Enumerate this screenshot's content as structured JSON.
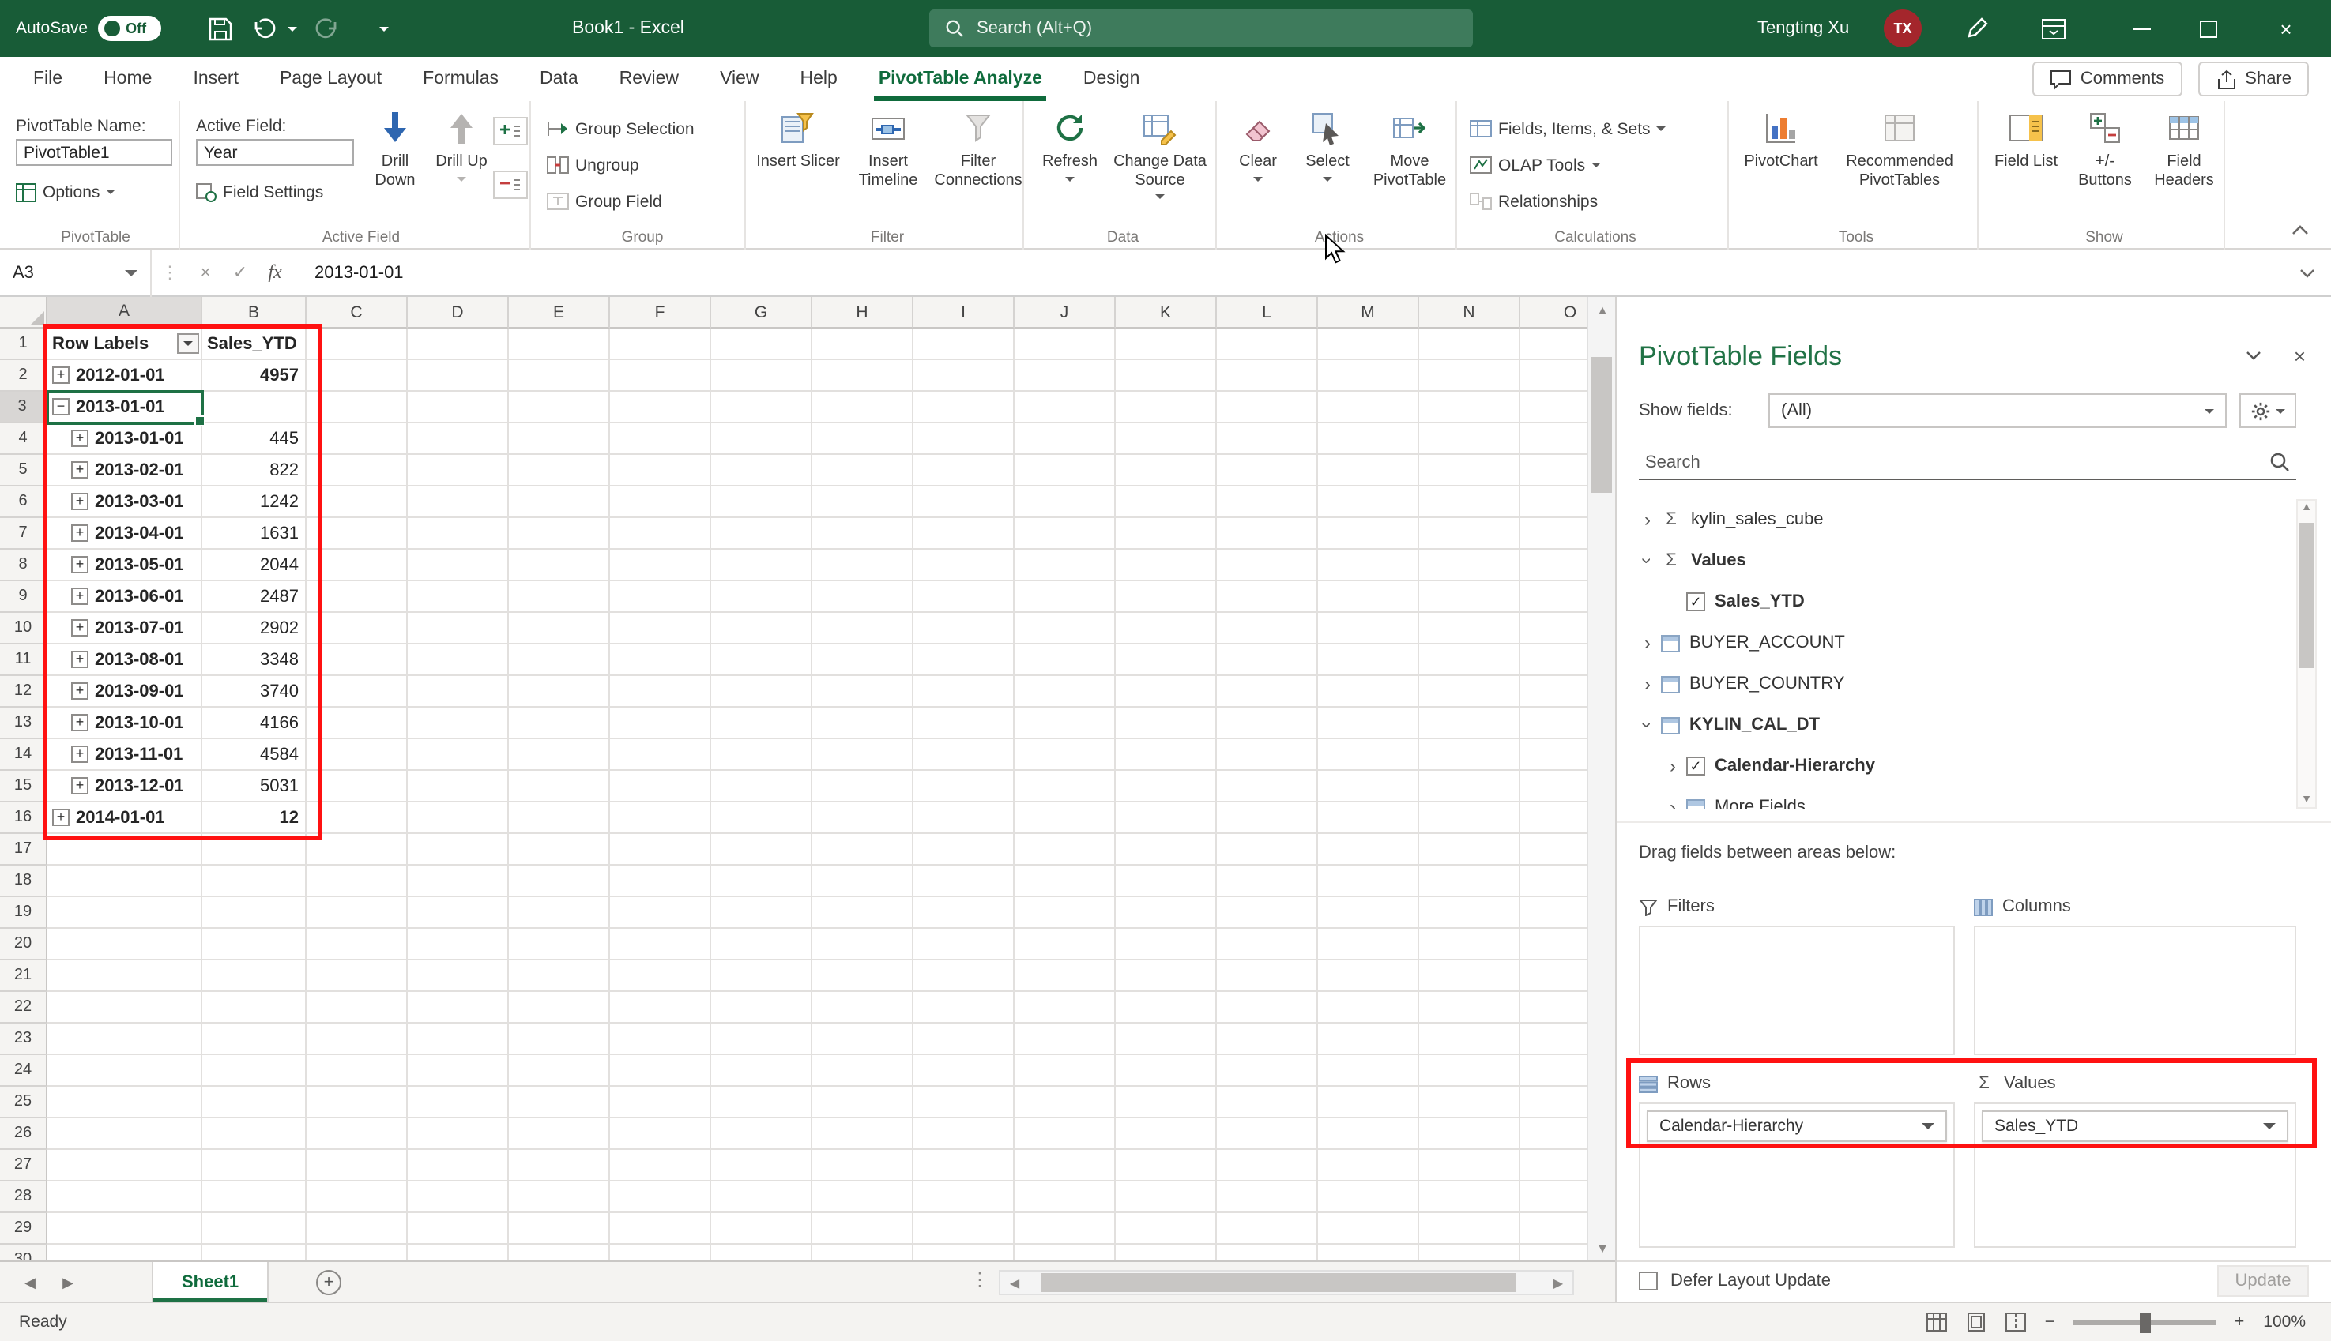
{
  "colors": {
    "titlebar_green": "#185C37",
    "accent_green": "#217346",
    "annotation_red": "#FF0000",
    "avatar_red": "#A4262C"
  },
  "titlebar": {
    "autosave_label": "AutoSave",
    "autosave_state": "Off",
    "document_title": "Book1 - Excel",
    "search_placeholder": "Search (Alt+Q)",
    "user_name": "Tengting Xu",
    "user_initials": "TX"
  },
  "menu": {
    "tabs": [
      "File",
      "Home",
      "Insert",
      "Page Layout",
      "Formulas",
      "Data",
      "Review",
      "View",
      "Help",
      "PivotTable Analyze",
      "Design"
    ],
    "active_tab": "PivotTable Analyze",
    "comments_label": "Comments",
    "share_label": "Share"
  },
  "ribbon": {
    "pivottable": {
      "group_label": "PivotTable",
      "name_label": "PivotTable Name:",
      "name_value": "PivotTable1",
      "options_label": "Options"
    },
    "active_field": {
      "group_label": "Active Field",
      "field_label": "Active Field:",
      "field_value": "Year",
      "settings_label": "Field Settings",
      "drill_down": "Drill Down",
      "drill_up": "Drill Up"
    },
    "group": {
      "group_label": "Group",
      "selection": "Group Selection",
      "ungroup": "Ungroup",
      "field": "Group Field"
    },
    "filter": {
      "group_label": "Filter",
      "slicer": "Insert Slicer",
      "timeline": "Insert Timeline",
      "connections": "Filter Connections"
    },
    "data": {
      "group_label": "Data",
      "refresh": "Refresh",
      "change_source": "Change Data Source"
    },
    "actions": {
      "group_label": "Actions",
      "clear": "Clear",
      "select": "Select",
      "move": "Move PivotTable"
    },
    "calculations": {
      "group_label": "Calculations",
      "fields_items": "Fields, Items, & Sets",
      "olap": "OLAP Tools",
      "relationships": "Relationships"
    },
    "tools": {
      "group_label": "Tools",
      "pivotchart": "PivotChart",
      "recommended": "Recommended PivotTables"
    },
    "show": {
      "group_label": "Show",
      "field_list": "Field List",
      "buttons": "+/- Buttons",
      "headers": "Field Headers"
    }
  },
  "formula_bar": {
    "name_box": "A3",
    "content": "2013-01-01"
  },
  "grid": {
    "visible_columns": [
      "A",
      "B",
      "C",
      "D",
      "E",
      "F",
      "G",
      "H",
      "I",
      "J",
      "K",
      "L",
      "M",
      "N",
      "O"
    ],
    "visible_rows": 30,
    "selected_cell": "A3",
    "pivot_table": {
      "header": {
        "a": "Row Labels",
        "b": "Sales_YTD"
      },
      "rows": [
        {
          "row": 2,
          "label": "2012-01-01",
          "value": "4957",
          "level": 0,
          "glyph": "+",
          "bold_value": true
        },
        {
          "row": 3,
          "label": "2013-01-01",
          "value": "",
          "level": 0,
          "glyph": "-",
          "selected": true
        },
        {
          "row": 4,
          "label": "2013-01-01",
          "value": "445",
          "level": 1,
          "glyph": "+"
        },
        {
          "row": 5,
          "label": "2013-02-01",
          "value": "822",
          "level": 1,
          "glyph": "+"
        },
        {
          "row": 6,
          "label": "2013-03-01",
          "value": "1242",
          "level": 1,
          "glyph": "+"
        },
        {
          "row": 7,
          "label": "2013-04-01",
          "value": "1631",
          "level": 1,
          "glyph": "+"
        },
        {
          "row": 8,
          "label": "2013-05-01",
          "value": "2044",
          "level": 1,
          "glyph": "+"
        },
        {
          "row": 9,
          "label": "2013-06-01",
          "value": "2487",
          "level": 1,
          "glyph": "+"
        },
        {
          "row": 10,
          "label": "2013-07-01",
          "value": "2902",
          "level": 1,
          "glyph": "+"
        },
        {
          "row": 11,
          "label": "2013-08-01",
          "value": "3348",
          "level": 1,
          "glyph": "+"
        },
        {
          "row": 12,
          "label": "2013-09-01",
          "value": "3740",
          "level": 1,
          "glyph": "+"
        },
        {
          "row": 13,
          "label": "2013-10-01",
          "value": "4166",
          "level": 1,
          "glyph": "+"
        },
        {
          "row": 14,
          "label": "2013-11-01",
          "value": "4584",
          "level": 1,
          "glyph": "+"
        },
        {
          "row": 15,
          "label": "2013-12-01",
          "value": "5031",
          "level": 1,
          "glyph": "+"
        },
        {
          "row": 16,
          "label": "2014-01-01",
          "value": "12",
          "level": 0,
          "glyph": "+",
          "bold_value": true
        }
      ]
    }
  },
  "sheet_tabs": {
    "active": "Sheet1"
  },
  "status_bar": {
    "mode": "Ready",
    "zoom": "100%"
  },
  "fields_pane": {
    "title": "PivotTable Fields",
    "show_fields_label": "Show fields:",
    "show_fields_value": "(All)",
    "search_placeholder": "Search",
    "tree": [
      {
        "label": "kylin_sales_cube",
        "icon": "sigma",
        "expander": "collapsed",
        "indent": 0
      },
      {
        "label": "Values",
        "icon": "sigma",
        "expander": "expanded",
        "indent": 0,
        "bold": true
      },
      {
        "label": "Sales_YTD",
        "icon": "checkbox-checked",
        "indent": 1,
        "bold": true
      },
      {
        "label": "BUYER_ACCOUNT",
        "icon": "table",
        "expander": "collapsed",
        "indent": 0
      },
      {
        "label": "BUYER_COUNTRY",
        "icon": "table",
        "expander": "collapsed",
        "indent": 0
      },
      {
        "label": "KYLIN_CAL_DT",
        "icon": "table",
        "expander": "expanded",
        "indent": 0,
        "bold": true
      },
      {
        "label": "Calendar-Hierarchy",
        "icon": "checkbox-checked",
        "expander": "collapsed",
        "indent": 1,
        "bold": true
      },
      {
        "label": "More Fields",
        "icon": "table",
        "expander": "collapsed",
        "indent": 1,
        "clipped": true
      }
    ],
    "drag_hint": "Drag fields between areas below:",
    "areas": {
      "filters": {
        "label": "Filters",
        "chips": []
      },
      "columns": {
        "label": "Columns",
        "chips": []
      },
      "rows": {
        "label": "Rows",
        "chips": [
          "Calendar-Hierarchy"
        ]
      },
      "values": {
        "label": "Values",
        "chips": [
          "Sales_YTD"
        ]
      }
    },
    "defer_label": "Defer Layout Update",
    "update_label": "Update"
  }
}
